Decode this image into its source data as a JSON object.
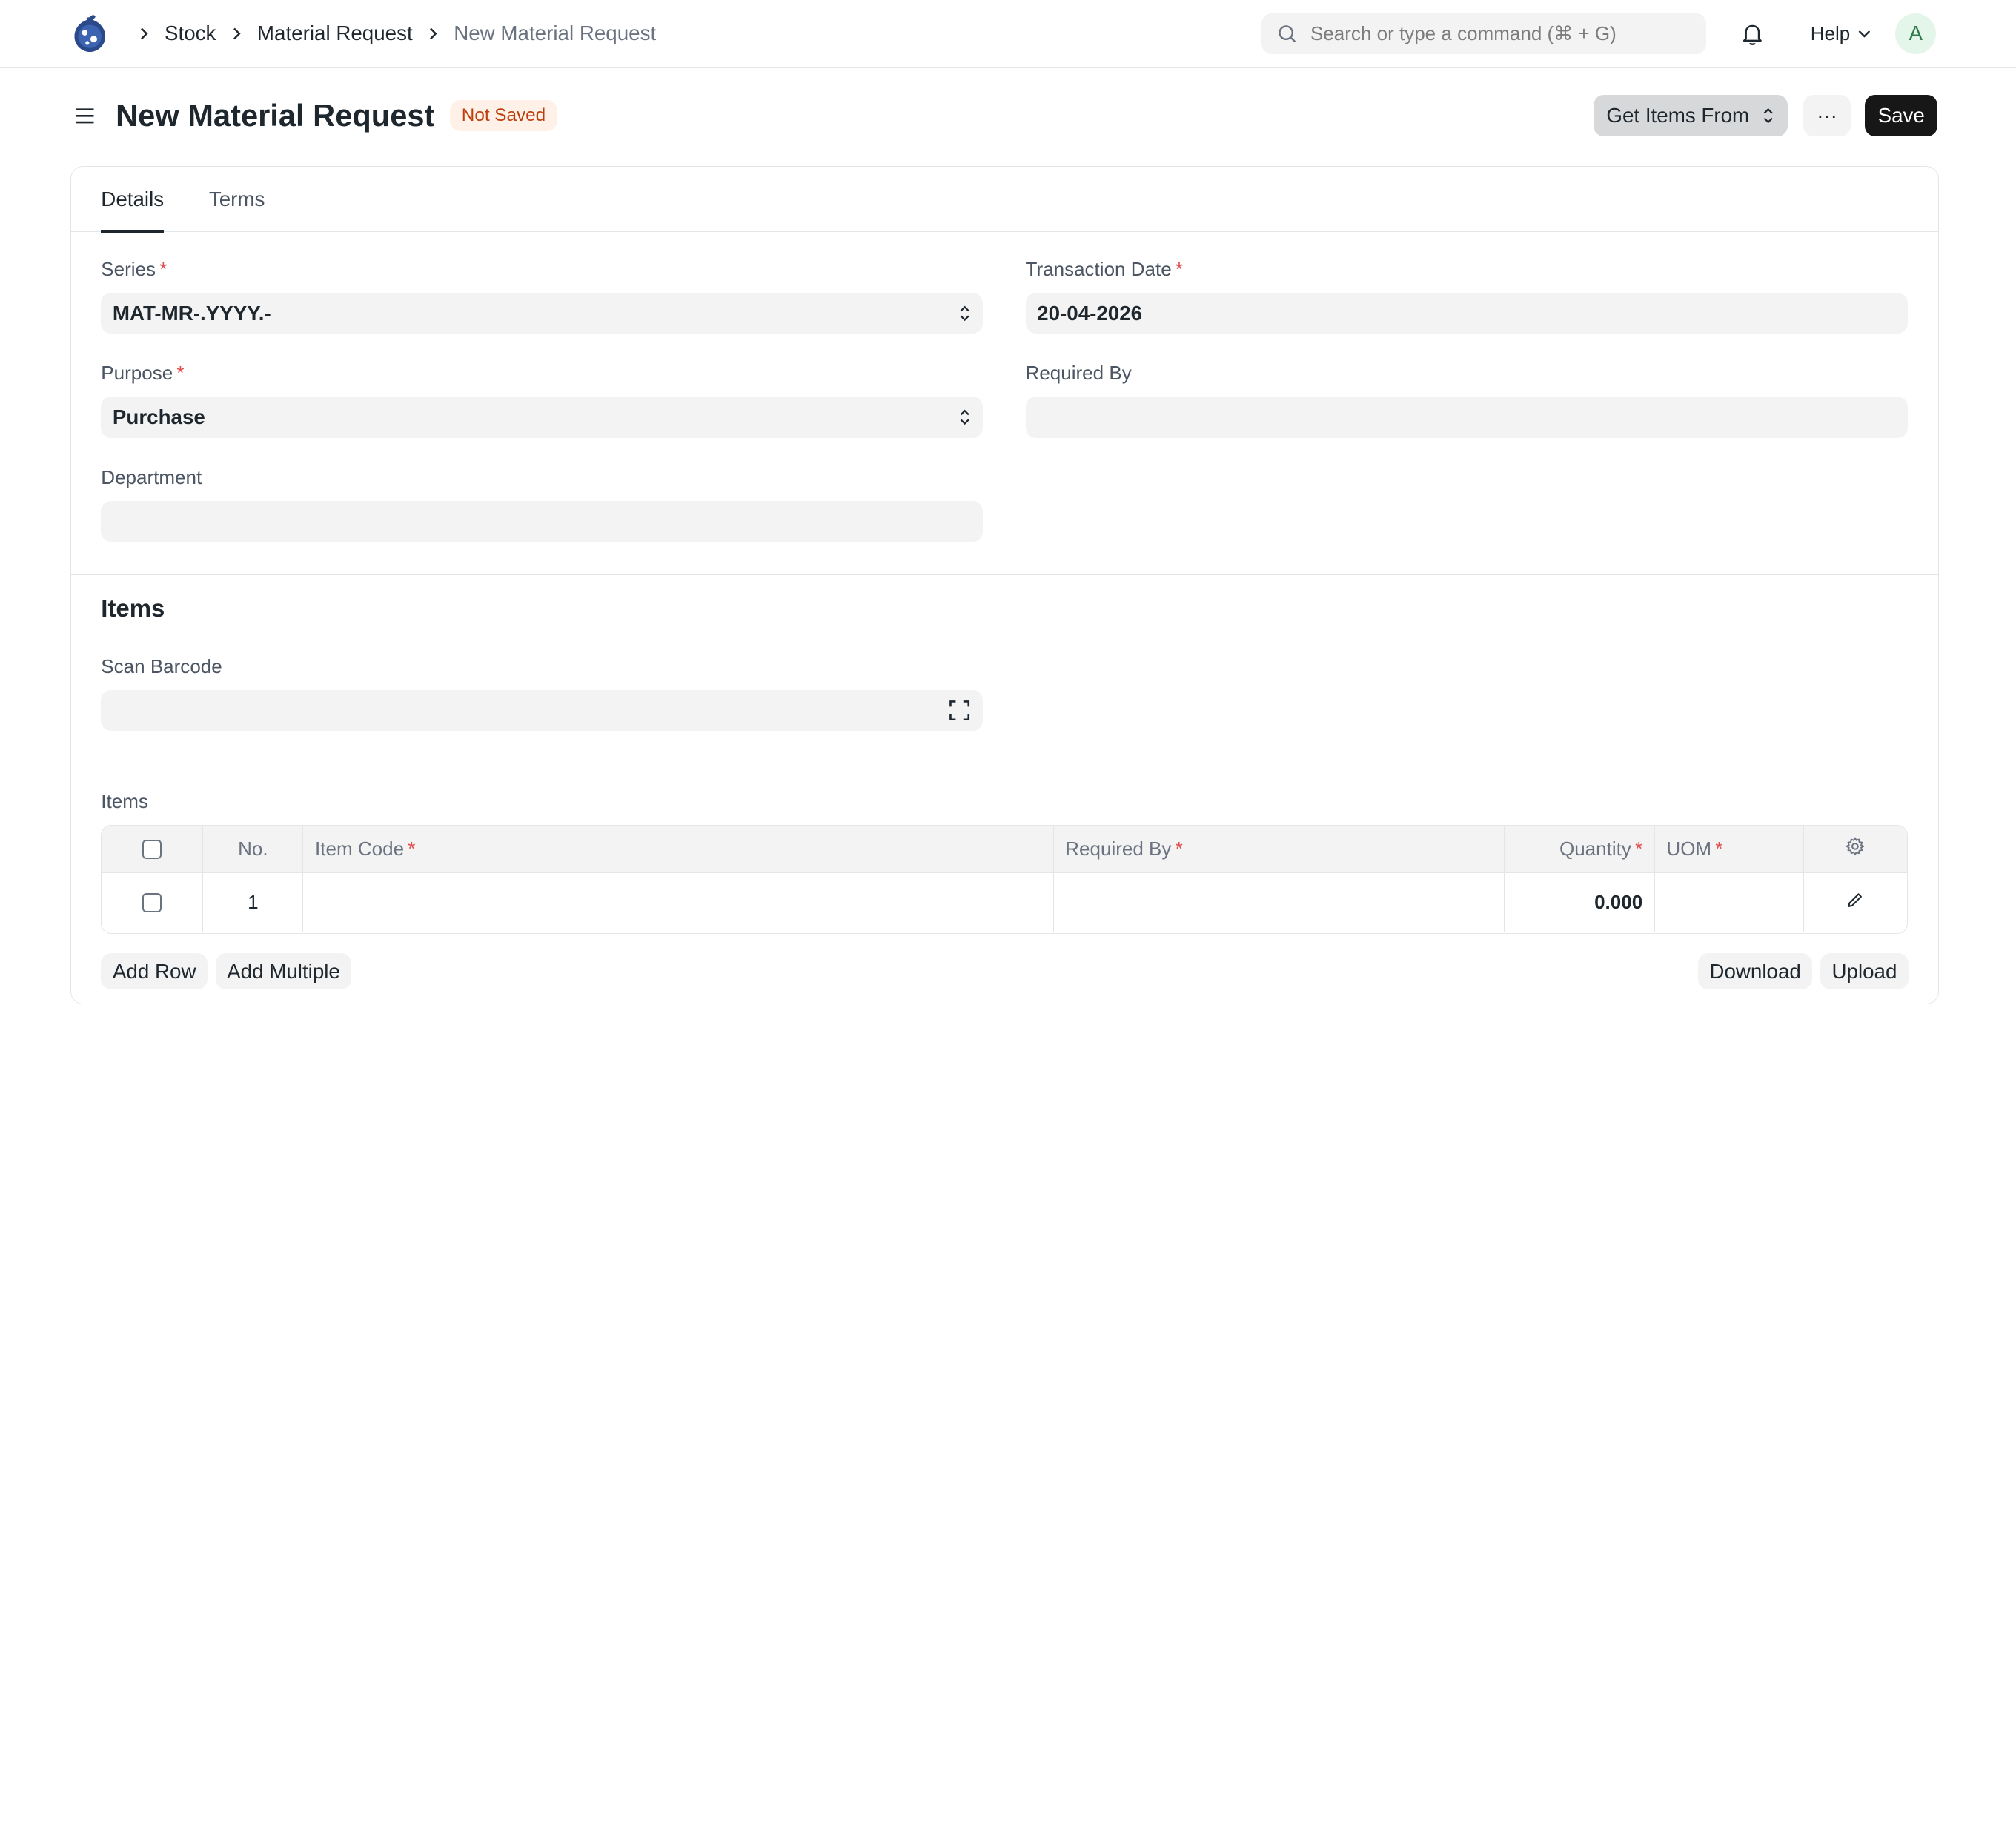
{
  "navbar": {
    "breadcrumbs": [
      "Stock",
      "Material Request",
      "New Material Request"
    ],
    "search_placeholder": "Search or type a command (⌘ + G)",
    "help_label": "Help",
    "avatar_initial": "A"
  },
  "page": {
    "title": "New Material Request",
    "status_badge": "Not Saved",
    "get_items_label": "Get Items From",
    "more_label": "···",
    "save_label": "Save"
  },
  "tabs": [
    {
      "label": "Details",
      "active": true
    },
    {
      "label": "Terms",
      "active": false
    }
  ],
  "fields": {
    "series": {
      "label": "Series",
      "value": "MAT-MR-.YYYY.-"
    },
    "transaction_date": {
      "label": "Transaction Date",
      "value": "20-04-2026"
    },
    "purpose": {
      "label": "Purpose",
      "value": "Purchase"
    },
    "required_by": {
      "label": "Required By",
      "value": ""
    },
    "department": {
      "label": "Department",
      "value": ""
    }
  },
  "items_section": {
    "title": "Items",
    "scan_barcode_label": "Scan Barcode",
    "table_label": "Items",
    "columns": {
      "no": "No.",
      "item_code": "Item Code",
      "required_by": "Required By",
      "quantity": "Quantity",
      "uom": "UOM"
    },
    "rows": [
      {
        "no": "1",
        "item_code": "",
        "required_by": "",
        "quantity": "0.000",
        "uom": ""
      }
    ],
    "actions": {
      "add_row": "Add Row",
      "add_multiple": "Add Multiple",
      "download": "Download",
      "upload": "Upload"
    }
  },
  "colors": {
    "primary_button": "#171717",
    "badge_bg": "#fff1e7",
    "badge_text": "#bc3e0d",
    "required_marker": "#e24c4c",
    "control_bg": "#f3f3f3"
  }
}
